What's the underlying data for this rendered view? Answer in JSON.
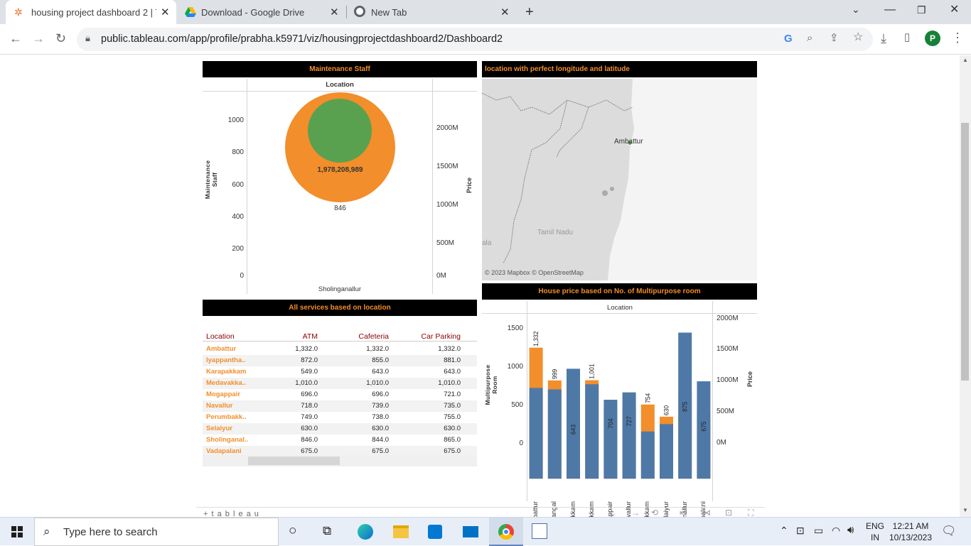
{
  "browser": {
    "tabs": [
      {
        "title": "housing project dashboard 2 | Ta"
      },
      {
        "title": "Download - Google Drive"
      },
      {
        "title": "New Tab"
      }
    ],
    "url": "public.tableau.com/app/profile/prabha.k5971/viz/housingprojectdashboard2/Dashboard2",
    "profile_initial": "P"
  },
  "dashboard": {
    "maintenance": {
      "title": "Maintenance Staff",
      "column_header": "Location",
      "y_label": "Maintenance Staff",
      "y2_label": "Price",
      "y_ticks": [
        "1000",
        "800",
        "600",
        "400",
        "200",
        "0"
      ],
      "y2_ticks": [
        "2000M",
        "1500M",
        "1000M",
        "500M",
        "0M"
      ],
      "price_label": "1,978,208,989",
      "staff_label": "846",
      "x_label": "Sholinganallur"
    },
    "map": {
      "title": "location with perfect longitude and latitude",
      "city": "Ambattur",
      "region": "Tamil Nadu",
      "edge_text": "ala",
      "attribution": "© 2023 Mapbox  © OpenStreetMap"
    },
    "services": {
      "title": "All services based on location",
      "columns": [
        "Location",
        "ATM",
        "Cafeteria",
        "Car Parking"
      ],
      "rows": [
        [
          "Ambattur",
          "1,332.0",
          "1,332.0",
          "1,332.0"
        ],
        [
          "Iyappantha..",
          "872.0",
          "855.0",
          "881.0"
        ],
        [
          "Karapakkam",
          "549.0",
          "643.0",
          "643.0"
        ],
        [
          "Medavakka..",
          "1,010.0",
          "1,010.0",
          "1,010.0"
        ],
        [
          "Mogappair",
          "696.0",
          "696.0",
          "721.0"
        ],
        [
          "Navallur",
          "718.0",
          "739.0",
          "735.0"
        ],
        [
          "Perumbakk..",
          "749.0",
          "738.0",
          "755.0"
        ],
        [
          "Selaiyur",
          "630.0",
          "630.0",
          "630.0"
        ],
        [
          "Sholinganal..",
          "846.0",
          "844.0",
          "865.0"
        ],
        [
          "Vadapalani",
          "675.0",
          "675.0",
          "675.0"
        ]
      ]
    },
    "house_price": {
      "title": "House price based on No. of Multipurpose room",
      "column_header": "Location",
      "y_label": "Multipurpose Room",
      "y2_label": "Price",
      "y_ticks": [
        "1500",
        "1000",
        "500",
        "0"
      ],
      "y2_ticks": [
        "2000M",
        "1500M",
        "1000M",
        "500M",
        "0M"
      ]
    }
  },
  "chart_data": {
    "type": "bar",
    "title": "House price based on No. of Multipurpose room",
    "xlabel": "Location",
    "ylabel": "Multipurpose Room",
    "y2label": "Price",
    "ylim": [
      0,
      1650
    ],
    "y2lim": [
      0,
      2200000000
    ],
    "categories": [
      "Ambattur",
      "Iyappanthangal",
      "Karapakkam",
      "Medavakkam",
      "Mogappair",
      "Navallur",
      "Perumbakkam",
      "Selaiyur",
      "Sholinganallur",
      "Vadapalani"
    ],
    "series": [
      {
        "values": [
          1332,
          999,
          643,
          1001,
          704,
          727,
          754,
          630,
          875,
          675
        ],
        "color": "#f28e2b"
      },
      {
        "values": [
          1230000000,
          1210000000,
          1490000000,
          1280000000,
          1070000000,
          1170000000,
          640000000,
          740000000,
          1980000000,
          1320000000
        ],
        "color": "#4e79a7"
      }
    ],
    "labels": [
      "1,332",
      "999",
      "643",
      "1,001",
      "704",
      "727",
      "754",
      "630",
      "875",
      "675"
    ]
  },
  "taskbar": {
    "search_placeholder": "Type here to search",
    "lang_top": "ENG",
    "lang_bottom": "IN",
    "time": "12:21 AM",
    "date": "10/13/2023"
  },
  "tableau_brand": "+ t a b l e a u"
}
